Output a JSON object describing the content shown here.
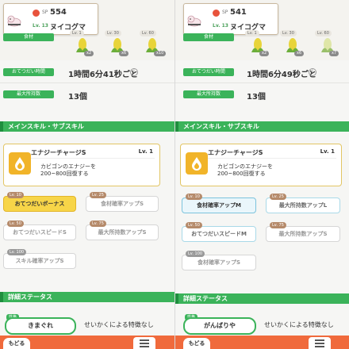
{
  "panels": [
    {
      "sp_label": "SP",
      "sp_value": "554",
      "level": "Lv. 13",
      "name": "ヌイコグマ",
      "ingredient_label": "食材",
      "ingredients": [
        {
          "lv": "Lv. 1",
          "qty": "x2"
        },
        {
          "lv": "Lv. 30",
          "qty": "x6"
        },
        {
          "lv": "Lv. 60",
          "qty": "x10"
        }
      ],
      "help_time_label": "おてつだい時間",
      "help_time_value": "1時間6分41秒ごと",
      "max_carry_label": "最大所持数",
      "max_carry_value": "13個",
      "section_skills": "メインスキル・サブスキル",
      "skill_name": "エナジーチャージS",
      "skill_level": "Lv. 1",
      "skill_desc": "カビゴンのエナジーを\n200~800回復する",
      "subskills": [
        {
          "lv": "Lv. 10",
          "label": "おてつだいボーナス",
          "style": "gold"
        },
        {
          "lv": "Lv. 25",
          "label": "食材確率アップS",
          "style": "grey"
        },
        {
          "lv": "Lv. 50",
          "label": "おてつだいスピードS",
          "style": "grey"
        },
        {
          "lv": "Lv. 75",
          "label": "最大所持数アップS",
          "style": "grey"
        },
        {
          "lv": "Lv. 100",
          "label": "スキル確率アップS",
          "style": "grey"
        }
      ],
      "section_details": "詳細ステータス",
      "nature_tag": "性格",
      "nature": "きまぐれ",
      "nature_effect": "せいかくによる特徴なし",
      "back_label": "もどる"
    },
    {
      "sp_label": "SP",
      "sp_value": "541",
      "level": "Lv. 13",
      "name": "ヌイコグマ",
      "ingredient_label": "食材",
      "ingredients": [
        {
          "lv": "Lv. 1",
          "qty": "x2"
        },
        {
          "lv": "Lv. 30",
          "qty": "x6"
        },
        {
          "lv": "Lv. 60",
          "qty": "x7"
        }
      ],
      "help_time_label": "おてつだい時間",
      "help_time_value": "1時間6分49秒ごと",
      "max_carry_label": "最大所持数",
      "max_carry_value": "13個",
      "section_skills": "メインスキル・サブスキル",
      "skill_name": "エナジーチャージS",
      "skill_level": "Lv. 1",
      "skill_desc": "カビゴンのエナジーを\n200~800回復する",
      "subskills": [
        {
          "lv": "Lv. 10",
          "label": "食材確率アップM",
          "style": "teal"
        },
        {
          "lv": "Lv. 25",
          "label": "最大所持数アップL",
          "style": "teal-o"
        },
        {
          "lv": "Lv. 50",
          "label": "おてつだいスピードM",
          "style": "teal-o"
        },
        {
          "lv": "Lv. 75",
          "label": "最大所持数アップS",
          "style": "grey"
        },
        {
          "lv": "Lv. 100",
          "label": "食材確率アップS",
          "style": "grey"
        }
      ],
      "section_details": "詳細ステータス",
      "nature_tag": "性格",
      "nature": "がんばりや",
      "nature_effect": "せいかくによる特徴なし",
      "back_label": "もどる"
    }
  ],
  "colors": {
    "accent_green": "#3bb35a",
    "gold": "#f7d548",
    "footer": "#f06a3c"
  }
}
